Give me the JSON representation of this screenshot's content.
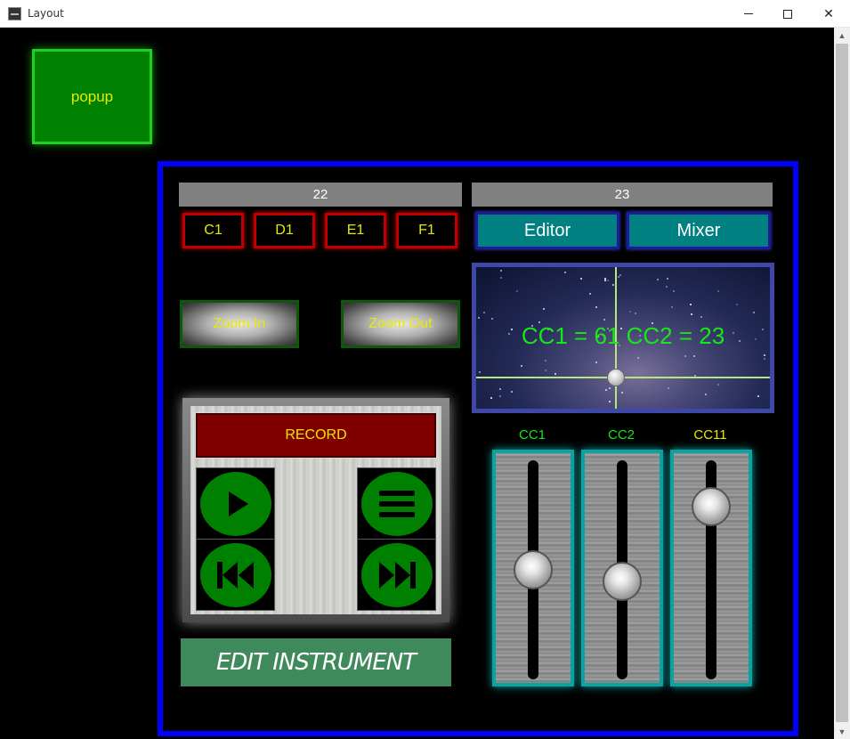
{
  "window": {
    "title": "Layout"
  },
  "popup": {
    "label": "popup"
  },
  "panel_left": {
    "header": "22",
    "notes": [
      "C1",
      "D1",
      "E1",
      "F1"
    ],
    "zoom_in": "Zoom In",
    "zoom_out": "Zoom Out",
    "record": "RECORD",
    "transport": {
      "play": "play-icon",
      "menu": "menu-icon",
      "rewind": "skip-back-icon",
      "forward": "skip-forward-icon"
    },
    "edit_instrument": "EDIT INSTRUMENT"
  },
  "panel_right": {
    "header": "23",
    "tabs": [
      "Editor",
      "Mixer"
    ],
    "xy_pad": {
      "label": "CC1 = 61  CC2 = 23",
      "cc1": 61,
      "cc2": 23
    },
    "faders": [
      {
        "label": "CC1",
        "label_color": "#19e619",
        "level": 0.48
      },
      {
        "label": "CC2",
        "label_color": "#19e619",
        "level": 0.42
      },
      {
        "label": "CC11",
        "label_color": "#e8e800",
        "level": 0.82
      }
    ]
  },
  "colors": {
    "frame": "#0000ff",
    "note_border": "#c00000",
    "tab_bg": "#008080",
    "text_yellow": "#e8e800",
    "cc_green": "#19e619"
  }
}
